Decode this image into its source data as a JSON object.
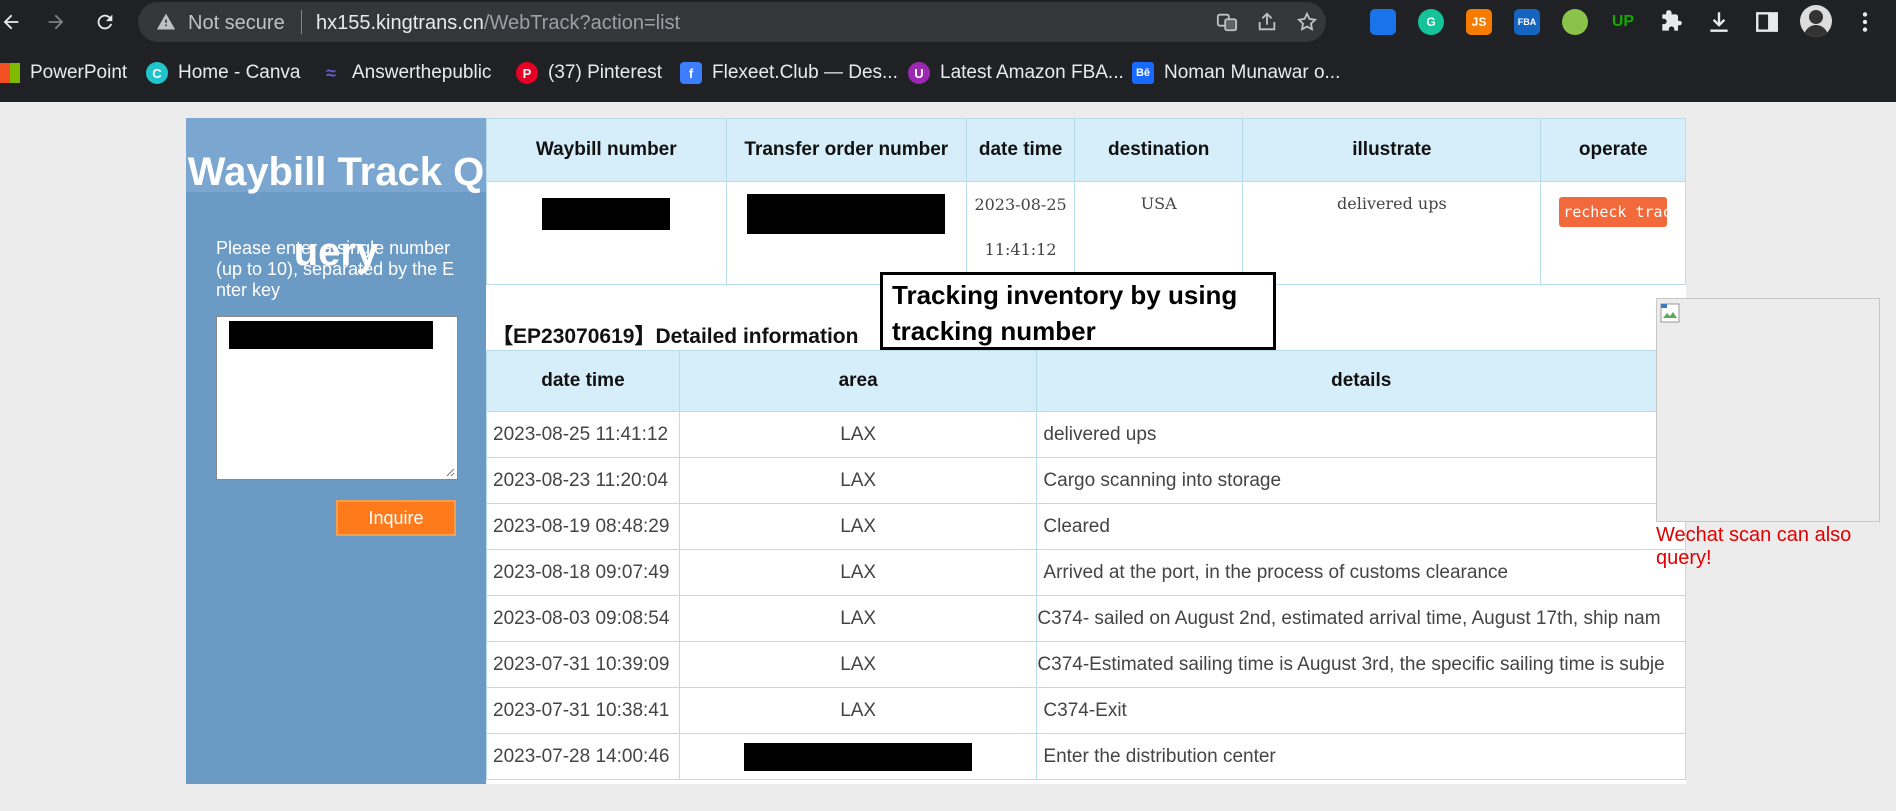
{
  "browser": {
    "security_label": "Not secure",
    "url_host": "hx155.kingtrans.cn",
    "url_path": "/WebTrack?action=list",
    "extensions": [
      {
        "name": "sellerboard",
        "color": "#1a73e8",
        "label": ""
      },
      {
        "name": "grammarly",
        "color": "#15c39a",
        "label": "G"
      },
      {
        "name": "js",
        "color": "#f57c00",
        "label": "JS"
      },
      {
        "name": "fba",
        "color": "#1565c0",
        "label": "FBA"
      },
      {
        "name": "lightbulb",
        "color": "#8bc34a",
        "label": ""
      },
      {
        "name": "upwork",
        "color": "#14a800",
        "label": "UP"
      }
    ],
    "bookmarks": [
      {
        "label": "PowerPoint",
        "icon": "microsoft-icon"
      },
      {
        "label": "Home - Canva",
        "icon": "canva-icon"
      },
      {
        "label": "Answerthepublic",
        "icon": "answerthepublic-icon"
      },
      {
        "label": "(37) Pinterest",
        "icon": "pinterest-icon"
      },
      {
        "label": "Flexeet.Club — Des...",
        "icon": "flexeet-icon"
      },
      {
        "label": "Latest Amazon FBA...",
        "icon": "amazon-fba-icon"
      },
      {
        "label": "Noman Munawar o...",
        "icon": "behance-icon"
      }
    ]
  },
  "sidebar": {
    "title": "Waybill Track Query",
    "instructions": "Please enter a single number (up to 10), separated by the Enter key",
    "inquire_label": "Inquire"
  },
  "summary": {
    "headers": [
      "Waybill number",
      "Transfer order number",
      "date time",
      "destination",
      "illustrate",
      "operate"
    ],
    "row": {
      "date_time": "2023-08-25 11:41:12",
      "destination": "USA",
      "illustrate": "delivered ups",
      "operate_label": "recheck track"
    }
  },
  "annotation": "Tracking inventory by using tracking number",
  "detail": {
    "heading": "【EP23070619】Detailed information",
    "headers": [
      "date time",
      "area",
      "details"
    ],
    "rows": [
      {
        "date_time": "2023-08-25 11:41:12",
        "area": "LAX",
        "details": "delivered ups"
      },
      {
        "date_time": "2023-08-23 11:20:04",
        "area": "LAX",
        "details": "Cargo scanning into storage"
      },
      {
        "date_time": "2023-08-19 08:48:29",
        "area": "LAX",
        "details": "Cleared"
      },
      {
        "date_time": "2023-08-18 09:07:49",
        "area": "LAX",
        "details": "Arrived at the port, in the process of customs clearance"
      },
      {
        "date_time": "2023-08-03 09:08:54",
        "area": "LAX",
        "details": "C374- sailed on August 2nd, estimated arrival time, August 17th, ship nam"
      },
      {
        "date_time": "2023-07-31 10:39:09",
        "area": "LAX",
        "details": "C374-Estimated sailing time is August 3rd, the specific sailing time is subje"
      },
      {
        "date_time": "2023-07-31 10:38:41",
        "area": "LAX",
        "details": "C374-Exit"
      },
      {
        "date_time": "2023-07-28 14:00:46",
        "area": "",
        "details": "Enter the distribution center"
      }
    ]
  },
  "wechat_note": "Wechat scan can also query!"
}
